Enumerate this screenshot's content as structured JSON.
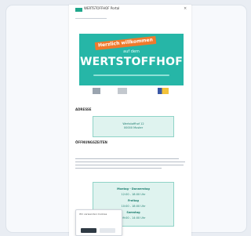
{
  "header": {
    "site_name": "WERTSTOFFHOF Portal",
    "close_symbol": "×"
  },
  "hero": {
    "ribbon": "Herzlich willkommen",
    "sub": "auf dem",
    "title": "WERTSTOFFHOF"
  },
  "sections": {
    "first": "ADRESSE",
    "second": "ÖFFNUNGSZEITEN"
  },
  "address_box": {
    "line1": "Wertstoffhof 12",
    "line2": "00000 Muster"
  },
  "hours": {
    "row1": "Montag - Donnerstag",
    "row2": "12:00 - 18:00 Uhr",
    "row3": "Freitag",
    "row4": "10:00 - 18:00 Uhr",
    "row5": "Samstag",
    "row6": "09:00 - 14:00 Uhr"
  },
  "consent": {
    "text": "Wir verwenden Cookies"
  },
  "colors": {
    "brand": "#26b6a7",
    "accent": "#f07a2c",
    "page_bg": "#e9edf3"
  }
}
